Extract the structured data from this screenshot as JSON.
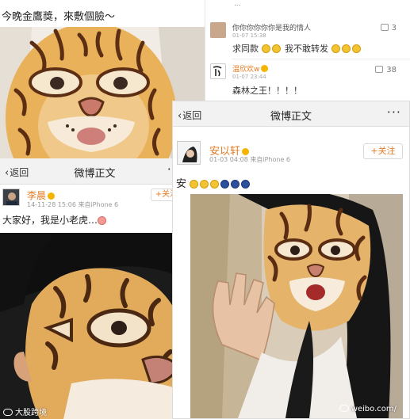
{
  "top_left": {
    "caption": "今晚金鷹獎，來敷個臉～"
  },
  "comments": {
    "top_partial": "...",
    "items": [
      {
        "user": "",
        "date": "01-07 15:38",
        "quote": "你你你你你你是我的情人",
        "body": "求同款",
        "likes": "3"
      },
      {
        "user": "温欣欢w",
        "date": "01-07 23:44",
        "body": "森林之王！！！！",
        "likes": "38"
      }
    ],
    "second_body_suffix": "我不敢转发"
  },
  "post_left": {
    "back": "返回",
    "title": "微博正文",
    "more": "···",
    "follow": "+关注",
    "user": "李晨",
    "meta": "14-11-28 15:06  来自iPhone 6",
    "text": "大家好，我是小老虎…",
    "watermark": "大股跨境"
  },
  "post_right": {
    "back": "返回",
    "title": "微博正文",
    "more": "···",
    "follow": "+关注",
    "user": "安以轩",
    "meta": "01-03 04:08  来自iPhone 6",
    "text": "安",
    "weibo_credit": "weibo.com/"
  },
  "colors": {
    "accent_orange": "#e67a22",
    "mask_yellow": "#e7b25a",
    "stripe_brown": "#5c2f14"
  }
}
